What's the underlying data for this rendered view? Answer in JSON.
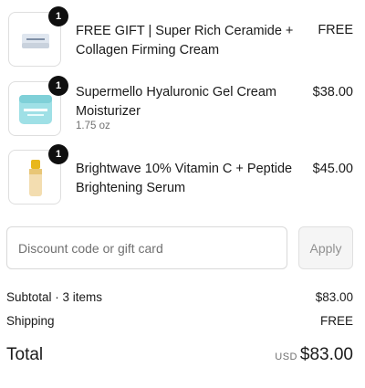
{
  "items": [
    {
      "name": "FREE GIFT | Super Rich Ceramide + Collagen Firming Cream",
      "variant": "",
      "price": "FREE",
      "quantity": "1",
      "icon": "cream-jar-icon"
    },
    {
      "name": "Supermello Hyaluronic Gel Cream Moisturizer",
      "variant": "1.75 oz",
      "price": "$38.00",
      "quantity": "1",
      "icon": "gel-cream-jar-icon"
    },
    {
      "name": "Brightwave 10% Vitamin C + Peptide Brightening Serum",
      "variant": "",
      "price": "$45.00",
      "quantity": "1",
      "icon": "serum-bottle-icon"
    }
  ],
  "discount": {
    "placeholder": "Discount code or gift card",
    "apply_label": "Apply"
  },
  "summary": {
    "subtotal_label": "Subtotal · 3 items",
    "subtotal_value": "$83.00",
    "shipping_label": "Shipping",
    "shipping_value": "FREE",
    "total_label": "Total",
    "currency": "USD",
    "total_value": "$83.00"
  },
  "colors": {
    "badge": "#0f0f0f",
    "border": "#dedede",
    "muted_text": "#707070",
    "apply_bg": "#f5f5f5"
  }
}
